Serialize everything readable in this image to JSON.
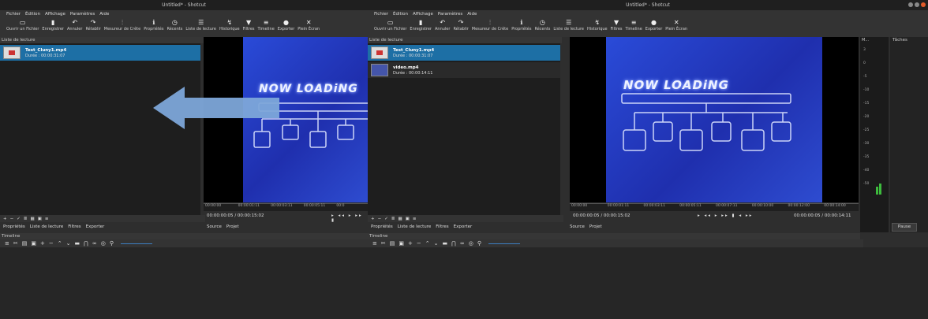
{
  "window": {
    "title": "Untitled* - Shotcut"
  },
  "menu": [
    "Fichier",
    "Édition",
    "Affichage",
    "Paramètres",
    "Aide"
  ],
  "toolbar": [
    {
      "icon": "folder-icon",
      "glyph": "▭",
      "label": "Ouvrir un Fichier"
    },
    {
      "icon": "save-icon",
      "glyph": "▮",
      "label": "Enregistrer"
    },
    {
      "icon": "undo-icon",
      "glyph": "↶",
      "label": "Annuler"
    },
    {
      "icon": "redo-icon",
      "glyph": "↷",
      "label": "Rétablir"
    },
    {
      "icon": "peak-meter-icon",
      "glyph": "⫶",
      "label": "Mesureur de Crête"
    },
    {
      "icon": "properties-icon",
      "glyph": "ℹ",
      "label": "Propriétés"
    },
    {
      "icon": "recent-icon",
      "glyph": "◷",
      "label": "Récents"
    },
    {
      "icon": "playlist-icon",
      "glyph": "☰",
      "label": "Liste de lecture"
    },
    {
      "icon": "history-icon",
      "glyph": "↯",
      "label": "Historique"
    },
    {
      "icon": "filters-icon",
      "glyph": "▼",
      "label": "Filtres"
    },
    {
      "icon": "timeline-icon",
      "glyph": "≡",
      "label": "Timeline"
    },
    {
      "icon": "export-icon",
      "glyph": "●",
      "label": "Exporter"
    },
    {
      "icon": "fullscreen-icon",
      "glyph": "✕",
      "label": "Plein Écran"
    }
  ],
  "playlist": {
    "header": "Liste de lecture",
    "left_items": [
      {
        "name": "Test_Cluny1.mp4",
        "duration": "Durée : 00:00:31:07"
      }
    ],
    "right_items": [
      {
        "name": "Test_Cluny1.mp4",
        "duration": "Durée : 00:00:31:07"
      },
      {
        "name": "video.mp4",
        "duration": "Durée : 00:00:14:11"
      }
    ]
  },
  "viewer": {
    "overlay_text": "NOW LOADiNG"
  },
  "left_ruler": [
    "00:00:00",
    "00:00:01:11",
    "00:00:03:11",
    "00:00:05:11",
    "00:0"
  ],
  "right_ruler": [
    "00:00:00",
    "00:00:01:11",
    "00:00:03:11",
    "00:00:05:11",
    "00:00:07:11",
    "00:00:10:00",
    "00:00:12:00",
    "00:00:14:00"
  ],
  "left_tc": {
    "pos": "00:00:00:05",
    "dur": "/ 00:00:15:02"
  },
  "right_tc": {
    "pos": "00:00:00:05",
    "dur": "/ 00:00:15:02",
    "out": "00:00:00:05 /   00:00:14:11"
  },
  "tabs": [
    "Propriétés",
    "Liste de lecture",
    "Filtres",
    "Exporter"
  ],
  "source_tabs": [
    "Source",
    "Projet"
  ],
  "timeline_header": "Timeline",
  "meter": {
    "header": "M...",
    "ticks": [
      "3",
      "0",
      "-5",
      "-10",
      "-15",
      "-20",
      "-25",
      "-30",
      "-35",
      "-40",
      "-50"
    ]
  },
  "jobs": {
    "header": "Tâches",
    "pause": "Pause"
  },
  "colors": {
    "selection": "#1d6fa5",
    "arrow": "#7da7d9",
    "accent_green": "#3dbb3d"
  }
}
